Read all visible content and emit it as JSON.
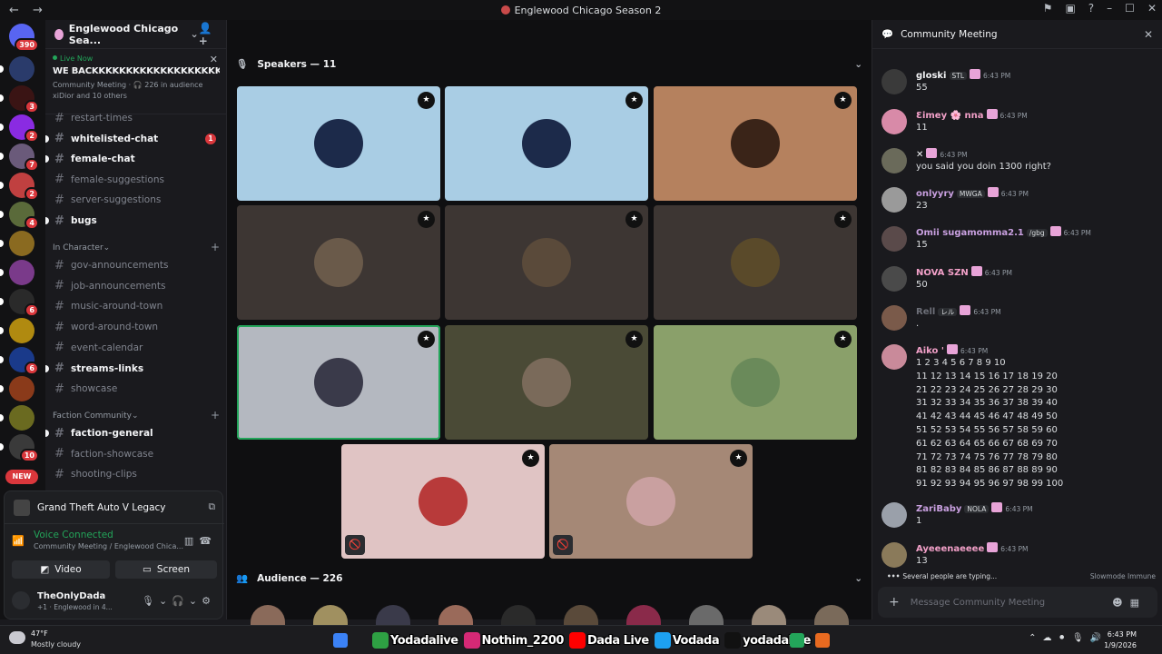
{
  "window": {
    "title": "Englewood Chicago Season 2"
  },
  "rail": {
    "servers": [
      {
        "badge": "390",
        "color": "#5865f2"
      },
      {
        "badge": "",
        "color": "#2a3b6b"
      },
      {
        "badge": "3",
        "color": "#3a1414"
      },
      {
        "badge": "2",
        "color": "#8a2be2"
      },
      {
        "badge": "7",
        "color": "#6a5a7a"
      },
      {
        "badge": "2",
        "color": "#c04040"
      },
      {
        "badge": "4",
        "color": "#5a6a3a"
      },
      {
        "badge": "",
        "color": "#8a6a20"
      },
      {
        "badge": "",
        "color": "#7a3a8a"
      },
      {
        "badge": "6",
        "color": "#2a2a2a"
      },
      {
        "badge": "",
        "color": "#b08a10"
      },
      {
        "badge": "6",
        "color": "#1a3a8a"
      },
      {
        "badge": "",
        "color": "#8a3a1a"
      },
      {
        "badge": "",
        "color": "#6a6a20"
      },
      {
        "badge": "10",
        "color": "#3a3a3a"
      }
    ],
    "new_label": "NEW"
  },
  "server": {
    "name": "Englewood Chicago Sea...",
    "live": {
      "label": "Live Now",
      "title": "WE BACKKKKKKKKKKKKKKKKKKKKK",
      "meta": "Community Meeting · 🎧 226 in audience",
      "others": "xiDior and 10 others"
    },
    "channels_top": [
      {
        "name": "restart-times",
        "unread": false,
        "badge": ""
      },
      {
        "name": "whitelisted-chat",
        "unread": true,
        "badge": "1"
      },
      {
        "name": "female-chat",
        "unread": true,
        "badge": ""
      },
      {
        "name": "female-suggestions",
        "unread": false,
        "badge": ""
      },
      {
        "name": "server-suggestions",
        "unread": false,
        "badge": ""
      },
      {
        "name": "bugs",
        "unread": true,
        "badge": ""
      }
    ],
    "cat_in_character": "In Character",
    "channels_ic": [
      {
        "name": "gov-announcements",
        "unread": false
      },
      {
        "name": "job-announcements",
        "unread": false
      },
      {
        "name": "music-around-town",
        "unread": false
      },
      {
        "name": "word-around-town",
        "unread": false
      },
      {
        "name": "event-calendar",
        "unread": false
      },
      {
        "name": "streams-links",
        "unread": true
      },
      {
        "name": "showcase",
        "unread": false
      }
    ],
    "cat_faction": "Faction Community",
    "channels_fc": [
      {
        "name": "faction-general",
        "unread": true
      },
      {
        "name": "faction-showcase",
        "unread": false
      },
      {
        "name": "shooting-clips",
        "unread": false
      }
    ]
  },
  "panel": {
    "game": "Grand Theft Auto V Legacy",
    "voice_status": "Voice Connected",
    "voice_sub": "Community Meeting / Englewood Chica...",
    "video_label": "Video",
    "screen_label": "Screen",
    "username": "TheOnlyDada",
    "user_status": "+1 · Englewood in 4..."
  },
  "stage": {
    "speakers_label": "Speakers — 11",
    "audience_label": "Audience — 226",
    "tiles": [
      {
        "bg": "#a9cde4",
        "avatar": "#1c2a4a",
        "speaking": false,
        "muted": false
      },
      {
        "bg": "#a9cde4",
        "avatar": "#1c2a4a",
        "speaking": false,
        "muted": false
      },
      {
        "bg": "#b5815e",
        "avatar": "#3a2418",
        "speaking": false,
        "muted": false
      },
      {
        "bg": "#3d3633",
        "avatar": "#6a5a4a",
        "speaking": false,
        "muted": false
      },
      {
        "bg": "#3d3633",
        "avatar": "#5a4a3a",
        "speaking": false,
        "muted": false
      },
      {
        "bg": "#3d3633",
        "avatar": "#5a4a2a",
        "speaking": false,
        "muted": false
      },
      {
        "bg": "#b4b8c0",
        "avatar": "#3a3a4a",
        "speaking": true,
        "muted": false
      },
      {
        "bg": "#4a4a36",
        "avatar": "#7a6a5a",
        "speaking": false,
        "muted": false
      },
      {
        "bg": "#8aa06a",
        "avatar": "#6a8a5a",
        "speaking": false,
        "muted": false
      },
      {
        "bg": "#e0c4c4",
        "avatar": "#b83a3a",
        "speaking": false,
        "muted": true
      },
      {
        "bg": "#a58876",
        "avatar": "#c9a0a0",
        "speaking": false,
        "muted": true
      }
    ],
    "audience": [
      "#8a6a5a",
      "#a09060",
      "#3a3a4a",
      "#9a6a5a",
      "#2a2a2a",
      "#5a4a3a",
      "#8a2a4a",
      "#6a6a6a",
      "#9a8a7a",
      "#7a6a5a"
    ]
  },
  "chat": {
    "title": "Community Meeting",
    "messages": [
      {
        "name": "gloski",
        "color": "#f2f3f5",
        "tag": "STL",
        "time": "6:43 PM",
        "text": "55",
        "avatar": "#3a3a3a"
      },
      {
        "name": "Ɛimey 🌸 nna",
        "color": "#f2a0c8",
        "tag": "",
        "time": "6:43 PM",
        "text": "11",
        "avatar": "#d88aa8"
      },
      {
        "name": "✕",
        "color": "#f2f3f5",
        "tag": "",
        "time": "6:43 PM",
        "text": "you said you doin 1300 right?",
        "avatar": "#6a6a5a"
      },
      {
        "name": "onlyyry",
        "color": "#c9a0e0",
        "tag": "MWGA",
        "time": "6:43 PM",
        "text": "23",
        "avatar": "#9a9a9a"
      },
      {
        "name": "Omii sugamomma2.1",
        "color": "#c9a0e0",
        "tag": "/gbg",
        "time": "6:43 PM",
        "text": "15",
        "avatar": "#5a4a4a"
      },
      {
        "name": "NOVA SZN",
        "color": "#f2a0c8",
        "tag": "",
        "time": "6:43 PM",
        "text": "50",
        "avatar": "#4a4a4a"
      },
      {
        "name": "Rell",
        "color": "#6d6f78",
        "tag": "レル",
        "time": "6:43 PM",
        "text": ".",
        "avatar": "#7a5a4a"
      },
      {
        "name": "Aiko '",
        "color": "#f2a0c8",
        "tag": "",
        "time": "6:43 PM",
        "text": "1 2 3 4 5 6 7 8 9 10\n11 12 13 14 15 16 17 18 19 20\n21 22 23 24 25 26 27 28 29 30\n31 32 33 34 35 36 37 38 39 40\n41 42 43 44 45 46 47 48 49 50\n51 52 53 54 55 56 57 58 59 60\n61 62 63 64 65 66 67 68 69 70\n71 72 73 74 75 76 77 78 79 80\n81 82 83 84 85 86 87 88 89 90\n91 92 93 94 95 96 97 98 99 100",
        "avatar": "#c98a9a"
      },
      {
        "name": "ZariBaby",
        "color": "#c9a0e0",
        "tag": "NOLA",
        "time": "6:43 PM",
        "text": "1",
        "avatar": "#9aa0aa"
      },
      {
        "name": "Ayeeenaeeee",
        "color": "#f2a0c8",
        "tag": "",
        "time": "6:43 PM",
        "text": "13",
        "avatar": "#8a7a5a"
      }
    ],
    "typing": "Several people are typing...",
    "slowmode": "Slowmode Immune",
    "input_placeholder": "Message Community Meeting"
  },
  "taskbar": {
    "temp": "47°F",
    "weather": "Mostly cloudy",
    "socials": [
      {
        "label": "Yodadalive",
        "color": "#2ea043"
      },
      {
        "label": "Nothim_2200",
        "color": "#d62976"
      },
      {
        "label": "Dada Live",
        "color": "#ff0000"
      },
      {
        "label": "Vodada",
        "color": "#1da1f2"
      },
      {
        "label": "yodadalive",
        "color": "#111111"
      }
    ],
    "time": "6:43 PM",
    "date": "1/9/2026"
  }
}
